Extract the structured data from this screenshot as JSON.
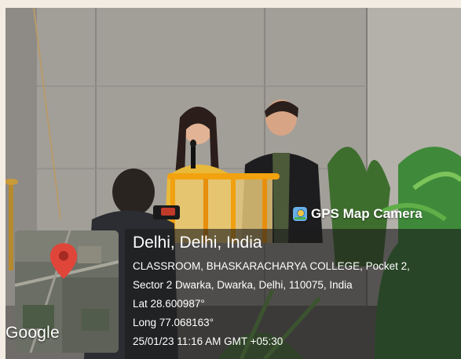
{
  "app": {
    "badge_label": "GPS Map Camera",
    "badge_icon": "camera-app-icon"
  },
  "location": {
    "title": "Delhi, Delhi, India",
    "address_line1": "CLASSROOM, BHASKARACHARYA COLLEGE, Pocket 2,",
    "address_line2": "Sector 2 Dwarka, Dwarka, Delhi, 110075, India",
    "latitude": "Lat 28.600987°",
    "longitude": "Long 77.068163°",
    "timestamp": "25/01/23 11:16 AM GMT +05:30"
  },
  "map": {
    "provider_label": "Google",
    "pin_icon": "map-pin-icon",
    "pin_color": "#e0453a"
  }
}
